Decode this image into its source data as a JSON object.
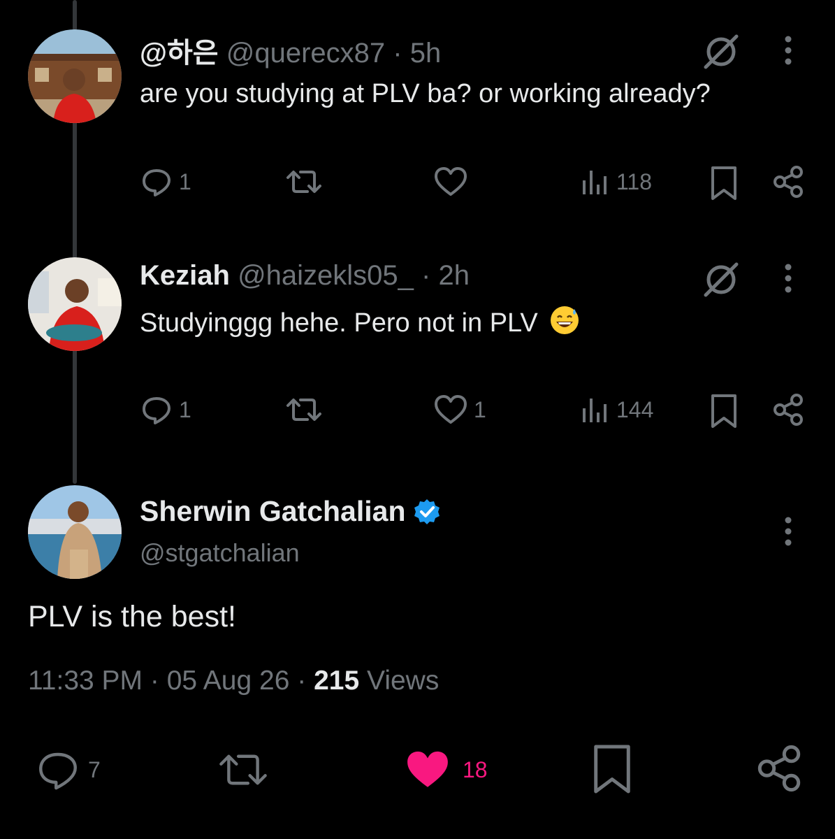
{
  "replies": [
    {
      "name": "@하은",
      "handle": "@querecx87",
      "separator": "·",
      "time": "5h",
      "text": "are you studying at PLV ba? or working already?",
      "reply_count": "1",
      "like_count": "",
      "views": "118"
    },
    {
      "name": "Keziah",
      "handle": "@haizekls05_",
      "separator": "·",
      "time": "2h",
      "text": "Studyinggg hehe. Pero not in PLV",
      "emoji": "sweat-smile-emoji",
      "reply_count": "1",
      "like_count": "1",
      "views": "144"
    }
  ],
  "main": {
    "name": "Sherwin Gatchalian",
    "handle": "@stgatchalian",
    "text": "PLV is the best!",
    "time": "11:33 PM",
    "date": "05 Aug 26",
    "separator": "·",
    "views_count": "215",
    "views_label": "Views",
    "reply_count": "7",
    "like_count": "18",
    "verified": true
  },
  "colors": {
    "background": "#000000",
    "text": "#e7e9ea",
    "muted": "#71767b",
    "like_active": "#f91880",
    "verified": "#1d9bf0",
    "thread_line": "#333639"
  },
  "icons": [
    "reply-icon",
    "retweet-icon",
    "heart-icon",
    "views-icon",
    "bookmark-icon",
    "share-icon",
    "grok-icon",
    "more-icon",
    "verified-badge-icon"
  ]
}
